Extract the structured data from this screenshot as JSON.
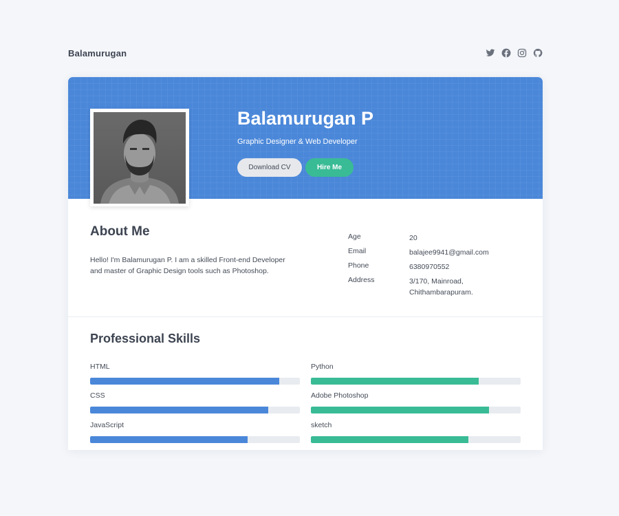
{
  "nav": {
    "brand": "Balamurugan",
    "socials": [
      "twitter-icon",
      "facebook-icon",
      "instagram-icon",
      "github-icon"
    ]
  },
  "profile": {
    "name": "Balamurugan P",
    "role": "Graphic Designer & Web Developer",
    "download_label": "Download CV",
    "hire_label": "Hire Me"
  },
  "about": {
    "title": "About Me",
    "text": "Hello! I'm Balamurugan P. I am a skilled Front-end Developer and master of Graphic Design tools such as Photoshop.",
    "info": [
      {
        "label": "Age",
        "value": "20"
      },
      {
        "label": "Email",
        "value": "balajee9941@gmail.com"
      },
      {
        "label": "Phone",
        "value": "6380970552"
      },
      {
        "label": "Address",
        "value": "3/170, Mainroad, Chithambarapuram."
      }
    ]
  },
  "skills": {
    "title": "Professional Skills",
    "items": [
      {
        "label": "HTML",
        "percent": 90
      },
      {
        "label": "Python",
        "percent": 80
      },
      {
        "label": "CSS",
        "percent": 85
      },
      {
        "label": "Adobe Photoshop",
        "percent": 85
      },
      {
        "label": "JavaScript",
        "percent": 75
      },
      {
        "label": "sketch",
        "percent": 75
      }
    ]
  },
  "colors": {
    "header_blue": "#4a87d9",
    "accent_green": "#39bb96",
    "track_gray": "#e8ebef"
  }
}
